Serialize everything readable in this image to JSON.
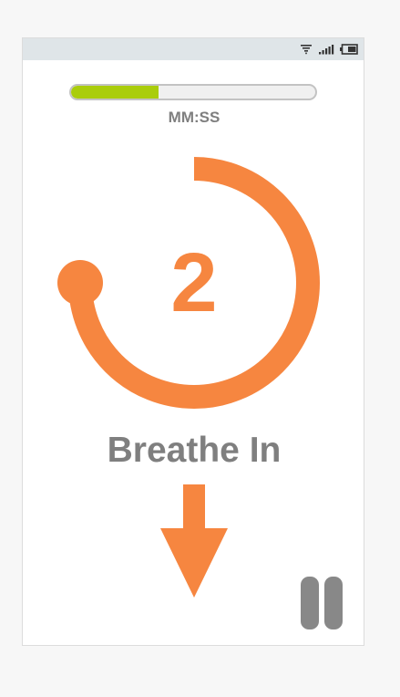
{
  "status_bar": {
    "icons": [
      "wifi-icon",
      "signal-icon",
      "battery-icon"
    ]
  },
  "session": {
    "progress_fraction": 0.36,
    "time_label": "MM:SS"
  },
  "breath": {
    "count": "2",
    "phase": "Breathe In",
    "ring_fraction": 0.75,
    "direction_icon": "arrow-down-icon"
  },
  "controls": {
    "pause_icon": "pause-icon"
  },
  "colors": {
    "accent": "#f68640",
    "progress": "#aacd0c",
    "text": "#7f7f7f",
    "pause": "#888888",
    "status_bar": "#dfe5e8"
  }
}
